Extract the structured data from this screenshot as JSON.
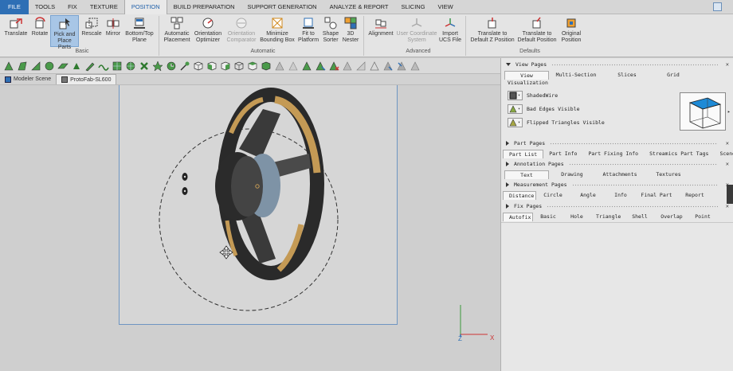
{
  "menu": {
    "items": [
      "FILE",
      "TOOLS",
      "FIX",
      "TEXTURE",
      "POSITION",
      "BUILD PREPARATION",
      "SUPPORT GENERATION",
      "ANALYZE & REPORT",
      "SLICING",
      "VIEW"
    ],
    "active": "POSITION"
  },
  "ribbon": {
    "buttons": [
      {
        "label": "Translate",
        "icon": "translate-icon"
      },
      {
        "label": "Rotate",
        "icon": "rotate-icon"
      },
      {
        "label": "Pick and Place Parts",
        "icon": "pick-place-icon"
      },
      {
        "label": "Rescale",
        "icon": "rescale-icon"
      },
      {
        "label": "Mirror",
        "icon": "mirror-icon"
      },
      {
        "label": "Bottom/Top Plane",
        "icon": "plane-icon"
      },
      {
        "label": "Automatic Placement",
        "icon": "auto-placement-icon"
      },
      {
        "label": "Orientation Optimizer",
        "icon": "orientation-icon"
      },
      {
        "label": "Orientation Comparator",
        "icon": "comparator-icon"
      },
      {
        "label": "Minimize Bounding Box",
        "icon": "bounding-box-icon"
      },
      {
        "label": "Fit to Platform",
        "icon": "fit-platform-icon"
      },
      {
        "label": "Shape Sorter",
        "icon": "shape-sorter-icon"
      },
      {
        "label": "3D Nester",
        "icon": "nester-icon"
      },
      {
        "label": "Alignment",
        "icon": "alignment-icon"
      },
      {
        "label": "User Coordinate System",
        "icon": "ucs-icon"
      },
      {
        "label": "Import UCS File",
        "icon": "import-ucs-icon"
      },
      {
        "label": "Translate to Default Z Position",
        "icon": "default-z-icon"
      },
      {
        "label": "Translate to Default Position",
        "icon": "default-pos-icon"
      },
      {
        "label": "Original Position",
        "icon": "original-pos-icon"
      }
    ],
    "groups": [
      "Basic",
      "Automatic",
      "Advanced",
      "Defaults"
    ]
  },
  "doc_tabs": [
    "Modeler Scene",
    "ProtoFab-SL600"
  ],
  "panel": {
    "view_pages": "View Pages",
    "view_tabs": [
      "View",
      "Multi-Section",
      "Slices",
      "Grid"
    ],
    "visualization": "Visualization",
    "vis_options": [
      "ShadedWire",
      "Bad Edges Visible",
      "Flipped Triangles Visible"
    ],
    "part_pages": "Part Pages",
    "part_tabs": [
      "Part List",
      "Part Info",
      "Part Fixing Info",
      "Streamics Part Tags",
      "Scenes"
    ],
    "annotation_pages": "Annotation Pages",
    "annotation_tabs": [
      "Text",
      "Drawing",
      "Attachments",
      "Textures"
    ],
    "measurement_pages": "Measurement Pages",
    "measurement_tabs": [
      "Distance",
      "Circle",
      "Angle",
      "Info",
      "Final Part",
      "Report"
    ],
    "fix_pages": "Fix Pages",
    "fix_tabs": [
      "Autofix",
      "Basic",
      "Hole",
      "Triangle",
      "Shell",
      "Overlap",
      "Point"
    ]
  },
  "axes": {
    "x": "X",
    "z": "Z"
  },
  "colors": {
    "accent": "#2e6fb5",
    "platform_border": "#6e95c2",
    "rim_tan": "#c49a55"
  }
}
